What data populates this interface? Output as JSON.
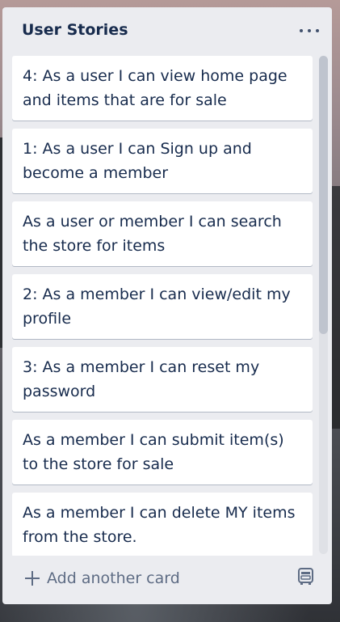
{
  "list": {
    "title": "User Stories",
    "menu_icon": "more-horizontal-icon"
  },
  "cards": [
    {
      "text": "4: As a user I can view home page and items that are for sale"
    },
    {
      "text": "1: As a user I can Sign up and become a member"
    },
    {
      "text": "As a user or member I can search the store for items"
    },
    {
      "text": "2: As a member I can view/edit my profile"
    },
    {
      "text": "3: As a member I can reset my password"
    },
    {
      "text": "As a member I can submit item(s) to the store for sale"
    },
    {
      "text": "As a member I can delete MY items from the store."
    }
  ],
  "footer": {
    "add_card_label": "Add another card",
    "add_icon": "plus-icon",
    "template_icon": "card-template-icon"
  },
  "colors": {
    "list_background": "#ebecf0",
    "card_background": "#ffffff",
    "title_text": "#172b4d",
    "muted_text": "#5e6c84"
  }
}
